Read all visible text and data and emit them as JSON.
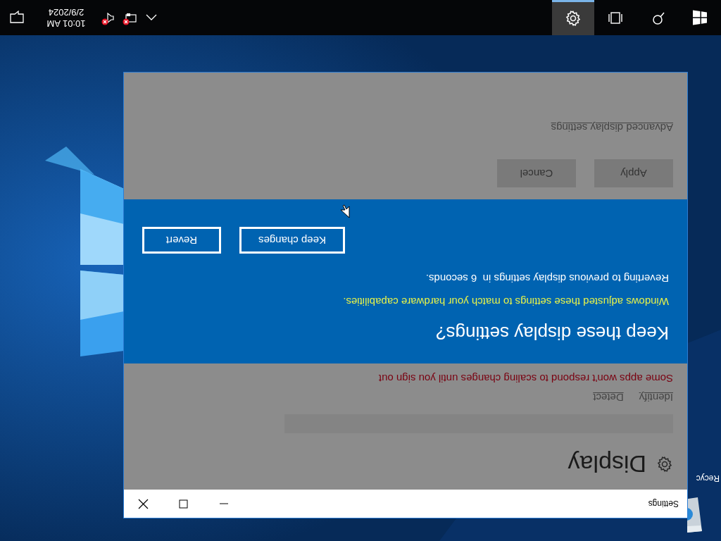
{
  "desktop_icons": [
    {
      "label": "Recyc"
    }
  ],
  "window": {
    "title": "Settings"
  },
  "page": {
    "heading": "Display",
    "links": [
      "Identify",
      "Detect"
    ],
    "warning": "Some apps won't respond to scaling changes until you sign out",
    "buttons": [
      "Apply",
      "Cancel"
    ],
    "advanced_link": "Advanced display settings"
  },
  "dialog": {
    "title": "Keep these display settings?",
    "message": "Windows adjusted these settings to match your hardware capabilities.",
    "countdown": "Reverting to previous display settings in  6 seconds.",
    "buttons": [
      "Keep changes",
      "Revert"
    ]
  },
  "taskbar": {
    "apps": [
      {
        "kind": "search",
        "selected": false
      },
      {
        "kind": "task_view",
        "selected": false
      },
      {
        "kind": "settings",
        "selected": true
      }
    ],
    "tray": [
      {
        "kind": "network",
        "alert": true
      },
      {
        "kind": "volume",
        "alert": true
      }
    ],
    "time": "10:01 AM",
    "date": "2/9/2024"
  }
}
